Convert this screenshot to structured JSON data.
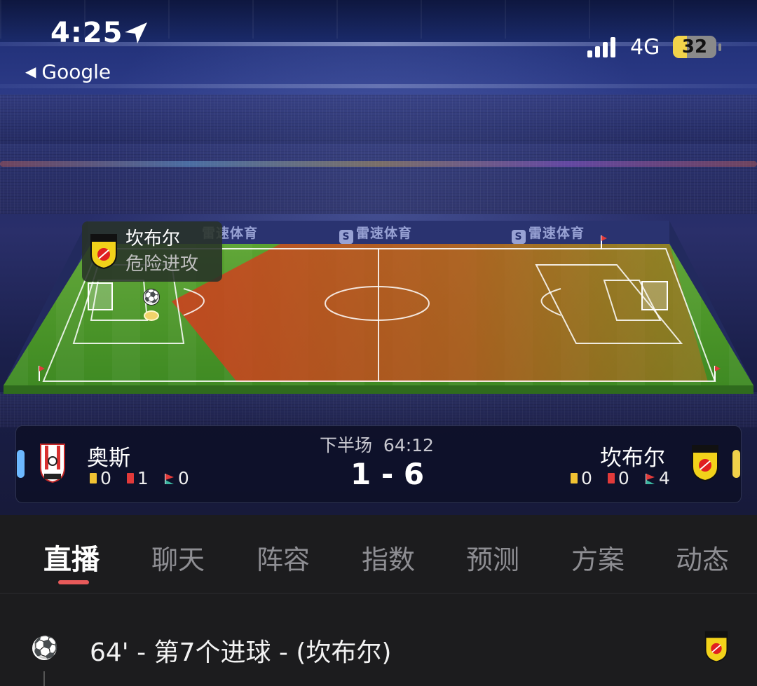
{
  "status_bar": {
    "time": "4:25",
    "back_app": "Google",
    "network": "4G",
    "battery": "32",
    "battery_level": 0.32
  },
  "ads": {
    "board_text": "雷速体育"
  },
  "attack_indicator": {
    "team": "坎布尔",
    "status": "危险进攻"
  },
  "match": {
    "period": "下半场",
    "clock": "64:12",
    "score": "1 - 6",
    "home": {
      "name": "奥斯",
      "yellow": "0",
      "red": "1",
      "corners": "0",
      "color": "#6cb8ff"
    },
    "away": {
      "name": "坎布尔",
      "yellow": "0",
      "red": "0",
      "corners": "4",
      "color": "#f1d14a"
    }
  },
  "tabs": [
    "直播",
    "聊天",
    "阵容",
    "指数",
    "预测",
    "方案",
    "动态"
  ],
  "active_tab": "直播",
  "events": [
    {
      "text": "64' - 第7个进球 - (坎布尔)",
      "icon": "soccer-ball-icon"
    }
  ]
}
